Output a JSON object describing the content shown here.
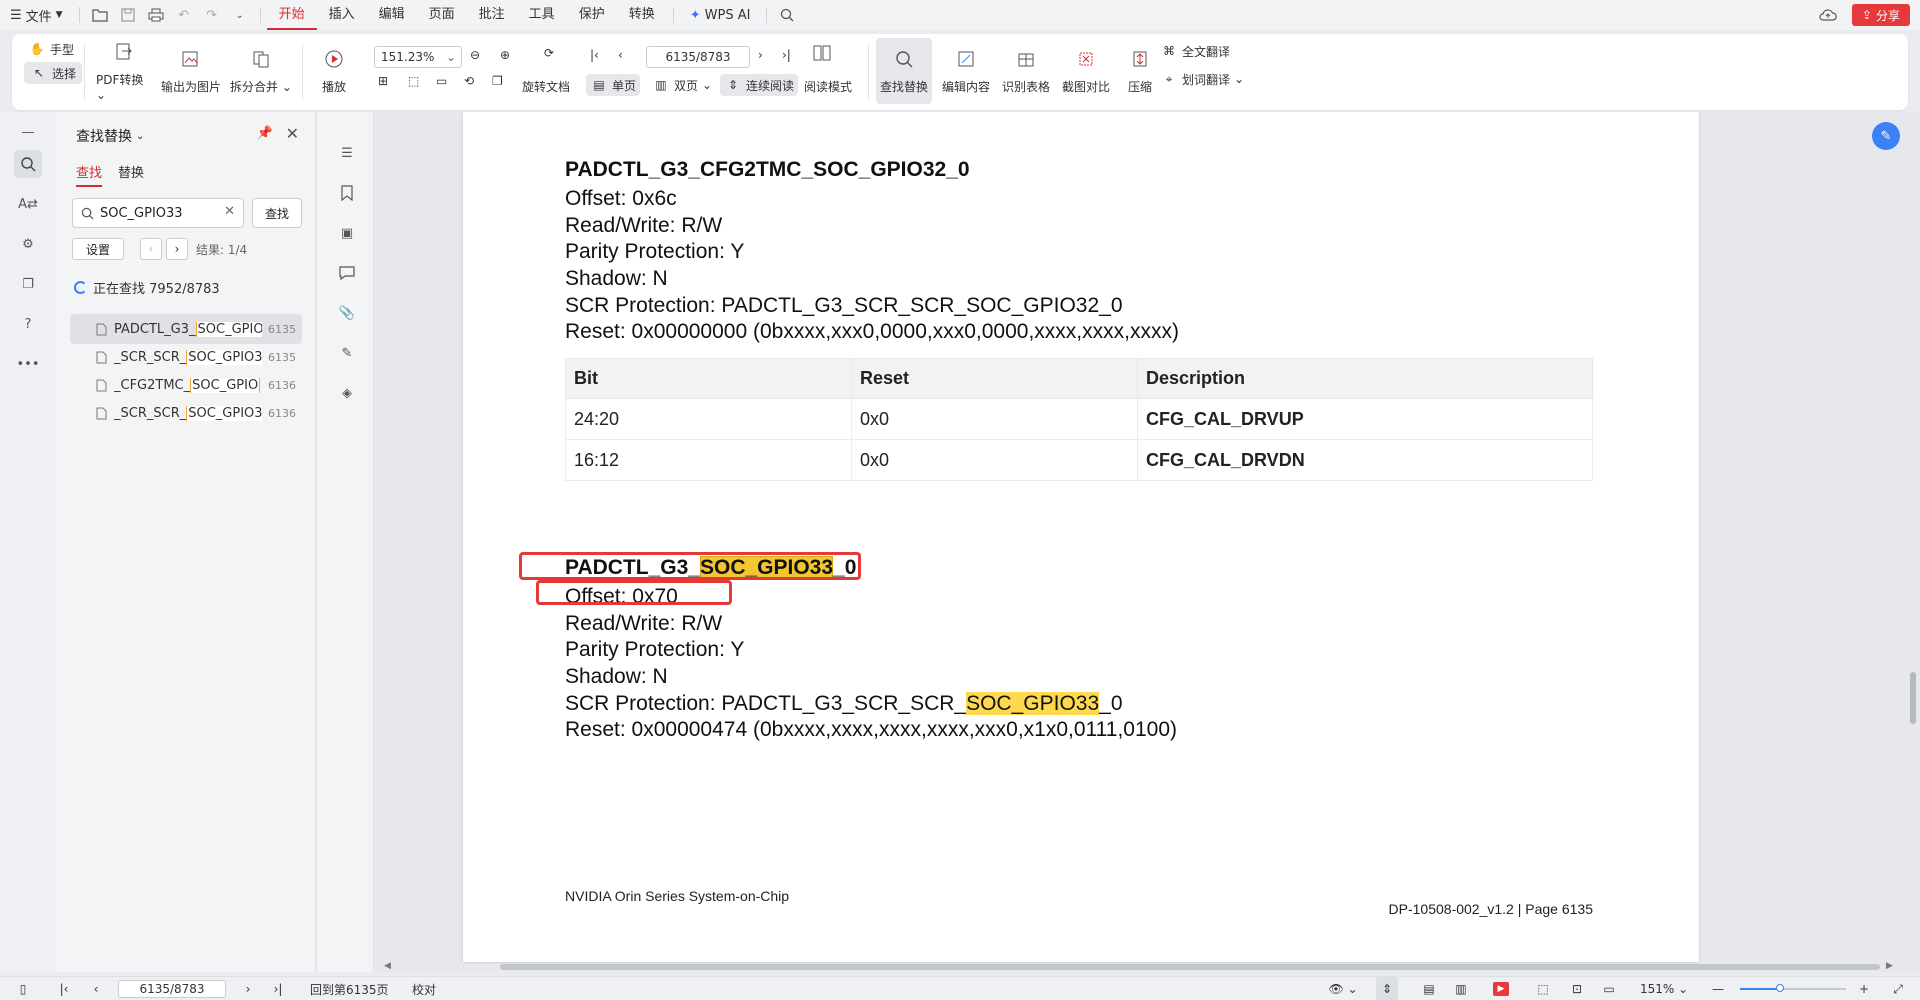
{
  "menubar": {
    "file": "文件",
    "tabs": [
      "开始",
      "插入",
      "编辑",
      "页面",
      "批注",
      "工具",
      "保护",
      "转换"
    ],
    "active_tab": "开始",
    "wps_ai": "WPS AI",
    "share": "分享"
  },
  "ribbon": {
    "hand": "手型",
    "select": "选择",
    "pdf_convert": "PDF转换",
    "export_image": "输出为图片",
    "split_merge": "拆分合并",
    "play": "播放",
    "zoom_value": "151.23%",
    "page_value": "6135/8783",
    "rotate": "旋转文档",
    "single": "单页",
    "double": "双页",
    "continuous": "连续阅读",
    "read_mode": "阅读模式",
    "find_replace": "查找替换",
    "edit_content": "编辑内容",
    "recognize_table": "识别表格",
    "screenshot_compare": "截图对比",
    "compress": "压缩",
    "full_translate": "全文翻译",
    "word_translate": "划词翻译"
  },
  "findpanel": {
    "title": "查找替换",
    "tab_find": "查找",
    "tab_replace": "替换",
    "query": "SOC_GPIO33",
    "find_button": "查找",
    "settings": "设置",
    "result_label": "结果: 1/4",
    "status": "正在查找 7952/8783",
    "results": [
      {
        "prefix": "PADCTL_G3_",
        "match": "SOC_GPIO",
        "page": "6135"
      },
      {
        "prefix": "_SCR_SCR_",
        "match": "SOC_GPIO3",
        "page": "6135"
      },
      {
        "prefix": "_CFG2TMC_",
        "match": "SOC_GPIO",
        "page": "6136"
      },
      {
        "prefix": "_SCR_SCR_",
        "match": "SOC_GPIO3",
        "page": "6136"
      }
    ]
  },
  "document": {
    "reg1": {
      "title": "PADCTL_G3_CFG2TMC_SOC_GPIO32_0",
      "offset": "Offset: 0x6c",
      "rw": "Read/Write: R/W",
      "parity": "Parity Protection: Y",
      "shadow": "Shadow: N",
      "scr": "SCR Protection: PADCTL_G3_SCR_SCR_SOC_GPIO32_0",
      "reset": "Reset: 0x00000000 (0bxxxx,xxx0,0000,xxx0,0000,xxxx,xxxx,xxxx)"
    },
    "table": {
      "headers": [
        "Bit",
        "Reset",
        "Description"
      ],
      "rows": [
        [
          "24:20",
          "0x0",
          "CFG_CAL_DRVUP"
        ],
        [
          "16:12",
          "0x0",
          "CFG_CAL_DRVDN"
        ]
      ]
    },
    "reg2": {
      "title_prefix": "PADCTL_G3_",
      "title_match": "SOC_GPIO33",
      "title_suffix": "_0",
      "offset": "Offset: 0x70",
      "rw": "Read/Write: R/W",
      "parity": "Parity Protection: Y",
      "shadow": "Shadow: N",
      "scr_prefix": "SCR Protection: PADCTL_G3_SCR_SCR_",
      "scr_match": "SOC_GPIO33",
      "scr_suffix": "_0",
      "reset": "Reset: 0x00000474 (0bxxxx,xxxx,xxxx,xxxx,xxx0,x1x0,0111,0100)"
    },
    "footer_left": "NVIDIA Orin Series System-on-Chip",
    "footer_right": "DP-10508-002_v1.2 | Page 6135"
  },
  "statusbar": {
    "page_value": "6135/8783",
    "goto_label": "回到第6135页",
    "proofread": "校对",
    "zoom": "151%",
    "zoom_level_fraction": 0.38
  },
  "colors": {
    "accent_red": "#d32f2f",
    "highlight": "#ffd94d",
    "annotation_red": "#e53935"
  }
}
